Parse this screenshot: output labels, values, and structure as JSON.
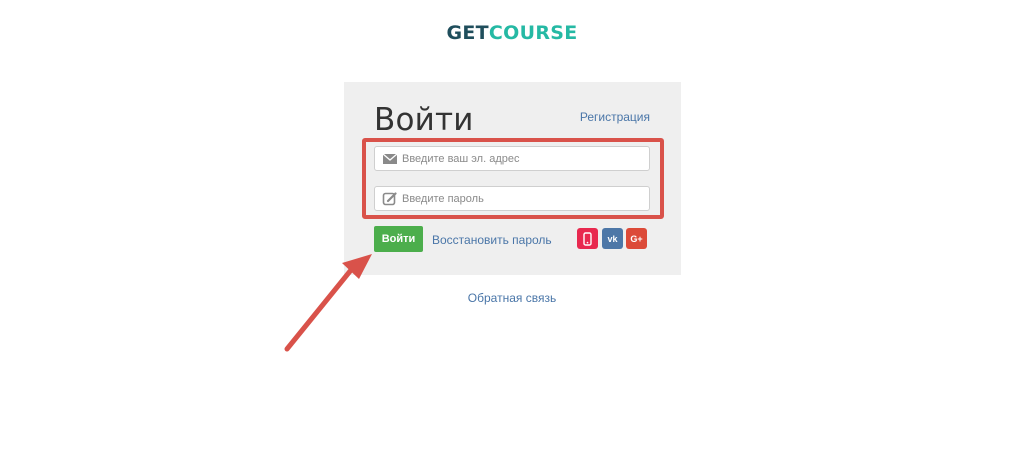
{
  "logo": {
    "part1": "GET",
    "part2": "COURSE"
  },
  "form": {
    "title": "Войти",
    "register_link": "Регистрация",
    "email_placeholder": "Введите ваш эл. адрес",
    "password_placeholder": "Введите пароль",
    "login_button": "Войти",
    "restore_link": "Восстановить пароль",
    "social": {
      "vk_label": "vk",
      "gplus_label": "G+"
    }
  },
  "footer": {
    "feedback_link": "Обратная связь"
  },
  "colors": {
    "logo_dark": "#1f4e5c",
    "logo_accent": "#25b9a4",
    "button_green": "#4cae4c",
    "link_blue": "#4a76a8",
    "annotation_red": "#d9524a",
    "phone_red": "#e8294f",
    "vk_blue": "#4d77a7",
    "gplus_red": "#dc4a38"
  },
  "icons": [
    "envelope-icon",
    "pencil-icon",
    "phone-icon",
    "vk-icon",
    "google-plus-icon"
  ]
}
